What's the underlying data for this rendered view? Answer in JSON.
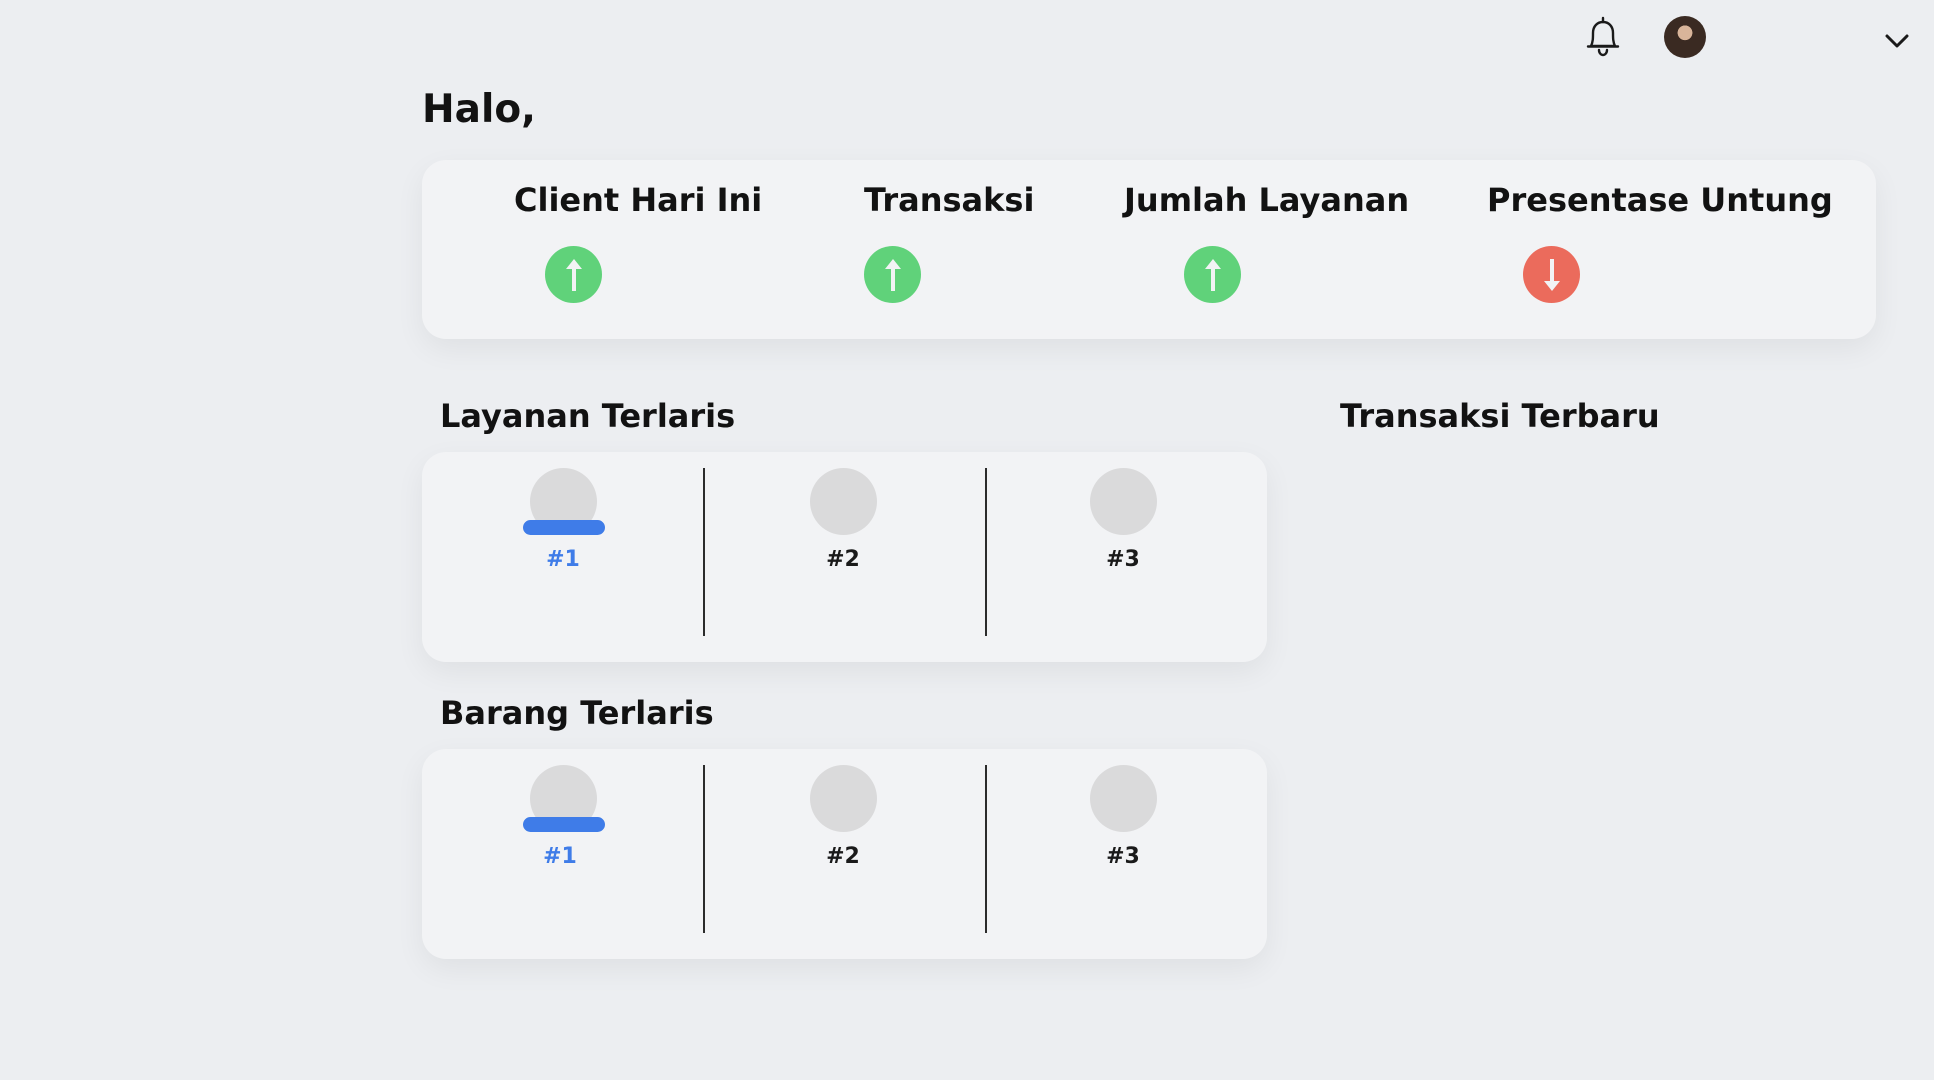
{
  "header": {
    "notification_icon": "bell-icon",
    "avatar_icon": "user-avatar",
    "menu_icon": "chevron-down-icon"
  },
  "greeting": "Halo,",
  "stats": [
    {
      "label": "Client Hari Ini",
      "trend": "up",
      "icon": "arrow-up-icon"
    },
    {
      "label": "Transaksi",
      "trend": "up",
      "icon": "arrow-up-icon"
    },
    {
      "label": "Jumlah Layanan",
      "trend": "up",
      "icon": "arrow-up-icon"
    },
    {
      "label": "Presentase Untung",
      "trend": "down",
      "icon": "arrow-down-icon"
    }
  ],
  "colors": {
    "up": "#60d27a",
    "down": "#eb6b5c",
    "accent": "#3f7ce8",
    "background": "#eceef1",
    "card": "#f2f3f5"
  },
  "layanan_terlaris": {
    "title": "Layanan Terlaris",
    "ranks": [
      {
        "label": "#1",
        "active": true
      },
      {
        "label": "#2",
        "active": false
      },
      {
        "label": "#3",
        "active": false
      }
    ]
  },
  "barang_terlaris": {
    "title": "Barang Terlaris",
    "ranks": [
      {
        "label": "#1",
        "active": true
      },
      {
        "label": "#2",
        "active": false
      },
      {
        "label": "#3",
        "active": false
      }
    ]
  },
  "transaksi_terbaru": {
    "title": "Transaksi Terbaru"
  }
}
